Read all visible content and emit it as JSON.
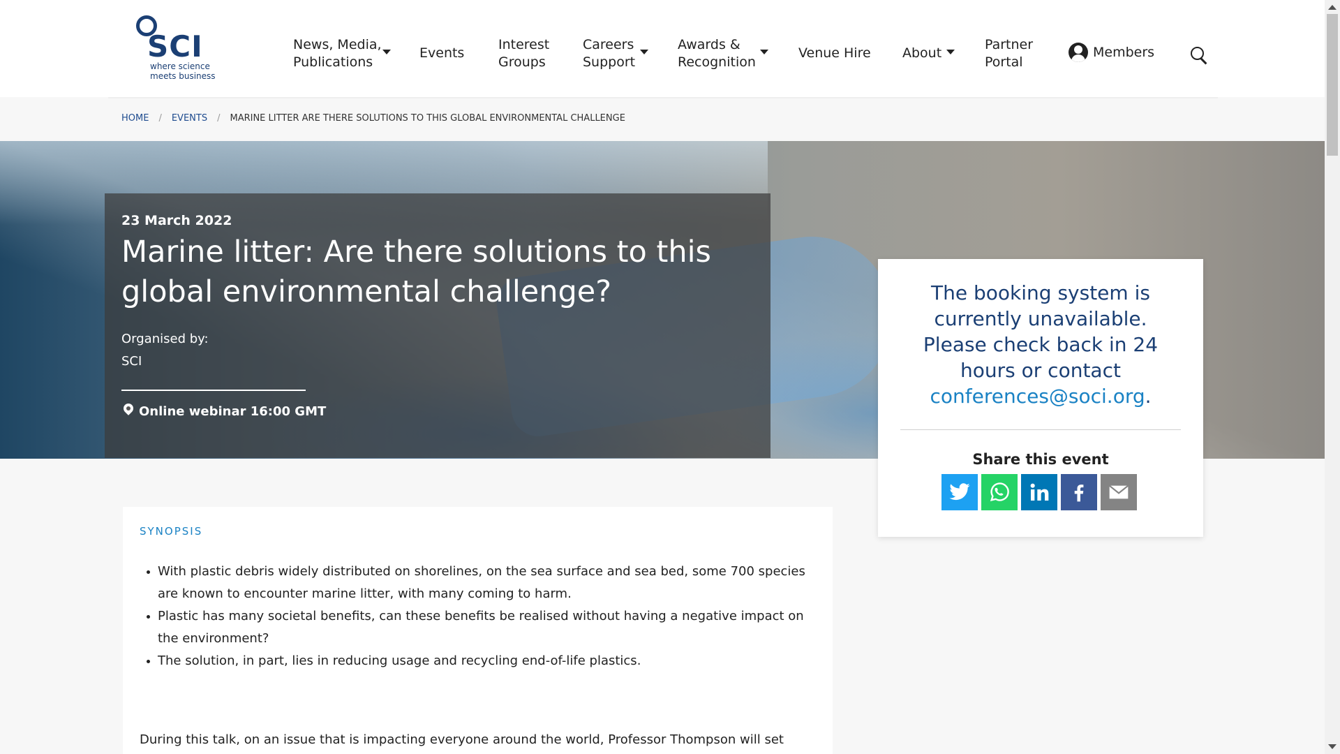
{
  "logo": {
    "text": "SCI",
    "tagline": "where science meets business"
  },
  "nav": {
    "items": [
      {
        "label": "News, Media,\nPublications",
        "has_dropdown": true
      },
      {
        "label": "Events",
        "has_dropdown": false
      },
      {
        "label": "Interest\nGroups",
        "has_dropdown": false
      },
      {
        "label": "Careers\nSupport",
        "has_dropdown": true
      },
      {
        "label": "Awards &\nRecognition",
        "has_dropdown": true
      },
      {
        "label": "Venue Hire",
        "has_dropdown": false
      },
      {
        "label": "About",
        "has_dropdown": true
      },
      {
        "label": "Partner\nPortal",
        "has_dropdown": false
      }
    ],
    "members_label": "Members",
    "icons": {
      "members": "person-icon",
      "search": "search-icon",
      "dropdown": "chevron-down-icon"
    }
  },
  "breadcrumb": {
    "home": "HOME",
    "separator": "/",
    "events": "EVENTS",
    "current": "MARINE LITTER ARE THERE SOLUTIONS TO THIS GLOBAL ENVIRONMENTAL CHALLENGE"
  },
  "event": {
    "date": "23 March 2022",
    "title": "Marine litter: Are there solutions to this global environmental challenge?",
    "organised_by_label": "Organised by:",
    "organiser": "SCI",
    "location": "Online webinar 16:00 GMT",
    "location_icon": "map-pin-icon"
  },
  "booking": {
    "message": "The booking system is currently unavailable. Please check back in 24 hours or contact",
    "email": "conferences@soci.org",
    "trailing": ".",
    "share_title": "Share this event",
    "share_buttons": [
      {
        "name": "twitter",
        "icon": "twitter-icon",
        "color": "#1da1f2"
      },
      {
        "name": "whatsapp",
        "icon": "whatsapp-icon",
        "color": "#25d366"
      },
      {
        "name": "linkedin",
        "icon": "linkedin-icon",
        "color": "#0077b5"
      },
      {
        "name": "facebook",
        "icon": "facebook-icon",
        "color": "#3b5998"
      },
      {
        "name": "email",
        "icon": "envelope-icon",
        "color": "#848484"
      }
    ]
  },
  "synopsis": {
    "label": "SYNOPSIS",
    "bullets": [
      "With plastic debris widely distributed on shorelines, on the sea surface and sea bed, some 700 species are known to encounter marine litter, with many coming to harm.",
      "Plastic has many societal benefits, can these benefits be realised without having a negative impact on the environment?",
      "The solution, in part, lies in reducing usage and recycling end-of-life plastics."
    ],
    "body": "During this talk, on an issue that is impacting everyone around the world, Professor Thompson will set"
  },
  "colors": {
    "brand_navy": "#1b3f74",
    "link_blue": "#1a82c4",
    "breadcrumb_link": "#1f4c8f"
  }
}
